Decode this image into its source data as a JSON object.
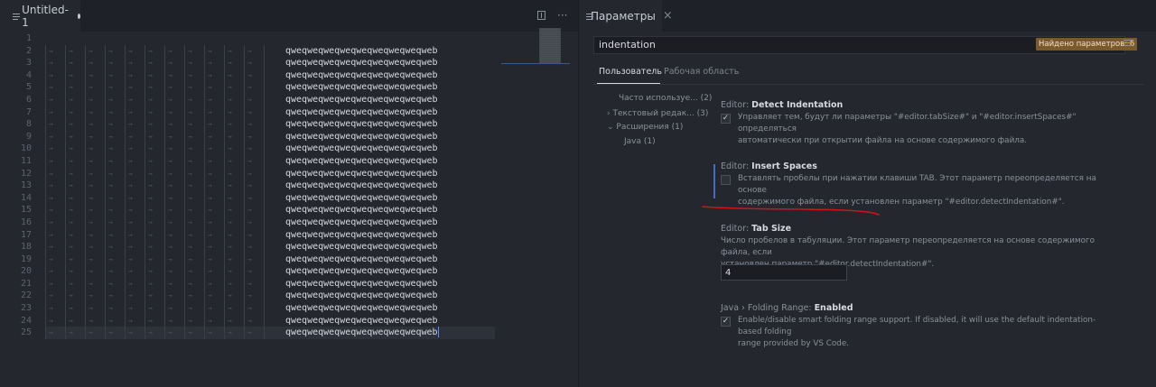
{
  "left_tab": {
    "title": "Untitled-1"
  },
  "right_tab": {
    "title": "Параметры",
    "close": "×"
  },
  "tab_actions": {
    "more": "···"
  },
  "editor": {
    "line_numbers": [
      "1",
      "2",
      "3",
      "4",
      "5",
      "6",
      "7",
      "8",
      "9",
      "10",
      "11",
      "12",
      "13",
      "14",
      "15",
      "16",
      "17",
      "18",
      "19",
      "20",
      "21",
      "22",
      "23",
      "24",
      "25"
    ],
    "lines": [
      "",
      "qweqweqweqweqweqweqweqweqweb",
      "qweqweqweqweqweqweqweqweqweb",
      "qweqweqweqweqweqweqweqweqweb",
      "qweqweqweqweqweqweqweqweqweb",
      "qweqweqweqweqweqweqweqweqweb",
      "qweqweqweqweqweqweqweqweqweb",
      "qweqweqweqweqweqweqweqweqweb",
      "qweqweqweqweqweqweqweqweqweb",
      "qweqweqweqweqweqweqweqweqweb",
      "qweqweqweqweqweqweqweqweqweb",
      "qweqweqweqweqweqweqweqweqweb",
      "qweqweqweqweqweqweqweqweqweb",
      "qweqweqweqweqweqweqweqweqweb",
      "qweqweqweqweqweqweqweqweqweb",
      "qweqweqweqweqweqweqweqweqweb",
      "qweqweqweqweqweqweqweqweqweb",
      "qweqweqweqweqweqweqweqweqweb",
      "qweqweqweqweqweqweqweqweqweb",
      "qweqweqweqweqweqweqweqweqweb",
      "qweqweqweqweqweqweqweqweqweb",
      "qweqweqweqweqweqweqweqweqweb",
      "qweqweqweqweqweqweqweqweqweb",
      "qweqweqweqweqweqweqweqweqweb",
      "qweqweqweqweqweqweqweqweqweb"
    ],
    "tab_arrow": "→"
  },
  "settings": {
    "search_value": "indentation",
    "found_label": "Найдено параметров: 6",
    "scope_user": "Пользователь",
    "scope_workspace": "Рабочая область",
    "toc": [
      {
        "label": "Часто используе...",
        "count": "(2)"
      },
      {
        "label": "Текстовый редак...",
        "count": "(3)"
      },
      {
        "label": "Расширения",
        "count": "(1)"
      },
      {
        "label": "Java",
        "count": "(1)"
      }
    ],
    "items": [
      {
        "category": "Editor: ",
        "name": "Detect Indentation",
        "desc_1": "Управляет тем, будут ли параметры \"#editor.tabSize#\" и \"#editor.insertSpaces#\" определяться",
        "desc_2": "автоматически при открытии файла на основе содержимого файла.",
        "checked": "✓"
      },
      {
        "category": "Editor: ",
        "name": "Insert Spaces",
        "desc_1": "Вставлять пробелы при нажатии клавиши TAB. Этот параметр переопределяется на основе",
        "desc_2": "содержимого файла, если установлен параметр \"#editor.detectIndentation#\"."
      },
      {
        "category": "Editor: ",
        "name": "Tab Size",
        "desc_1": "Число пробелов в табуляции. Этот параметр переопределяется на основе содержимого файла, если",
        "desc_2": "установлен параметр \"#editor.detectIndentation#\".",
        "value": "4"
      },
      {
        "category": "Java › Folding Range: ",
        "name": "Enabled",
        "desc_1": "Enable/disable smart folding range support. If disabled, it will use the default indentation-based folding",
        "desc_2": "range provided by VS Code.",
        "checked": "✓"
      }
    ]
  },
  "colors": {
    "annotation": "#d0141b",
    "accent": "#528bff"
  }
}
